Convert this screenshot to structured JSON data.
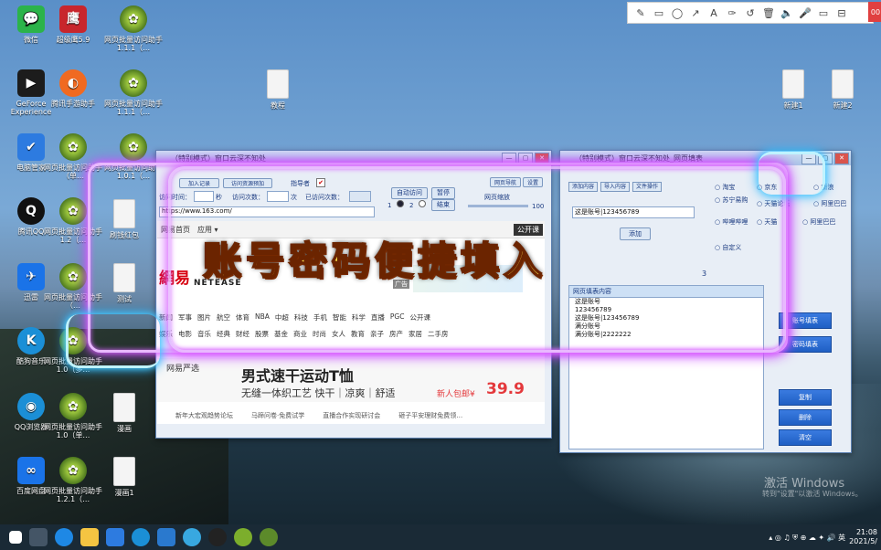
{
  "desktop_icons": [
    {
      "id": "wechat",
      "label": "微信",
      "style": "ic-green",
      "glyph": "💬"
    },
    {
      "id": "chaojiying",
      "label": "超级鹰5.9",
      "style": "ic-red",
      "glyph": "鹰"
    },
    {
      "id": "visit1",
      "label": "网页批量访问助手1.1.1（…",
      "style": "ic-tree",
      "glyph": "✿"
    },
    {
      "id": "geforce",
      "label": "GeForce Experience",
      "style": "ic-dark",
      "glyph": "▶"
    },
    {
      "id": "tencent-hand",
      "label": "腾讯手游助手",
      "style": "ic-orange",
      "glyph": "◐"
    },
    {
      "id": "visit2",
      "label": "网页批量访问助手1.1.1（…",
      "style": "ic-tree",
      "glyph": "✿"
    },
    {
      "id": "dianjiao",
      "label": "电脑管家",
      "style": "ic-shield",
      "glyph": "✔"
    },
    {
      "id": "visit3",
      "label": "网页批量访问助手（单…",
      "style": "ic-tree",
      "glyph": "✿"
    },
    {
      "id": "visit4",
      "label": "网页批量访问助手1.0.1（…",
      "style": "ic-tree",
      "glyph": "✿"
    },
    {
      "id": "qq",
      "label": "腾讯QQ",
      "style": "ic-qq",
      "glyph": "Q"
    },
    {
      "id": "visit5",
      "label": "网页批量访问助手1.2（…",
      "style": "ic-tree",
      "glyph": "✿"
    },
    {
      "id": "xunlei",
      "label": "迅雷",
      "style": "ic-blue",
      "glyph": "✈"
    },
    {
      "id": "visit6",
      "label": "网页批量访问助手（…",
      "style": "ic-tree",
      "glyph": "✿"
    },
    {
      "id": "kugou",
      "label": "酷狗音乐",
      "style": "ic-teal",
      "glyph": "K"
    },
    {
      "id": "visit7",
      "label": "网页批量访问助手1.0（多…",
      "style": "ic-tree",
      "glyph": "✿"
    },
    {
      "id": "qqbrowser",
      "label": "QQ浏览器",
      "style": "ic-teal",
      "glyph": "◉"
    },
    {
      "id": "visit8",
      "label": "网页批量访问助手1.0（单…",
      "style": "ic-tree",
      "glyph": "✿"
    },
    {
      "id": "baidunetdisk",
      "label": "百度网盘",
      "style": "ic-blue",
      "glyph": "∞"
    },
    {
      "id": "visit9",
      "label": "网页批量访问助手1.2.1（…",
      "style": "ic-tree",
      "glyph": "✿"
    },
    {
      "id": "file-manhua",
      "label": "漫画",
      "style": "ic-file",
      "glyph": ""
    },
    {
      "id": "file-manhua1",
      "label": "漫画1",
      "style": "ic-file",
      "glyph": ""
    },
    {
      "id": "file-shuayu",
      "label": "刷钱红包",
      "style": "ic-file",
      "glyph": ""
    },
    {
      "id": "file-ceshi",
      "label": "测试",
      "style": "ic-file",
      "glyph": ""
    },
    {
      "id": "file-guanggao",
      "label": "教程",
      "style": "ic-file",
      "glyph": ""
    },
    {
      "id": "file-right1",
      "label": "新建1",
      "style": "ic-file",
      "glyph": ""
    },
    {
      "id": "file-right2",
      "label": "新建2",
      "style": "ic-file",
      "glyph": ""
    }
  ],
  "annotation_toolbar": {
    "tools": [
      "✎",
      "▭",
      "◯",
      "↗",
      "A",
      "✑",
      "↺",
      "🗑",
      "🔈",
      "🎤",
      "▭",
      "⊟"
    ],
    "record": "00"
  },
  "left_window": {
    "title": "（特别模式）窗口云深不知处",
    "buttons": [
      "加入记录",
      "访问资源预加",
      "指导者"
    ],
    "visit_time_label": "访问时间：",
    "sec": "秒",
    "visit_count_label": "访问次数：",
    "times": "次",
    "visited_label": "已访问次数：",
    "auto_visit": "自动访问",
    "pause": "暂停",
    "end": "结束",
    "url": "https://www.163.com/",
    "speed_label": "网页缩放",
    "speed_val": "100",
    "radio_1": "1",
    "radio_2": "2",
    "right_top_btns": [
      "网页导航",
      "设置"
    ]
  },
  "browser": {
    "nav": [
      "网易首页",
      "应用 ▾"
    ],
    "open_class": "公开课",
    "logo_cn": "網易",
    "logo_en": "NETEASE",
    "ad_label": "广告",
    "rows": [
      [
        "新闻",
        "军事",
        "图片",
        "航空",
        "体育",
        "NBA",
        "中超",
        "科技",
        "手机",
        "智能",
        "科学",
        "直播",
        "PGC",
        "公开课"
      ],
      [
        "娱乐",
        "电影",
        "音乐",
        "经典",
        "财经",
        "股票",
        "基金",
        "商业",
        "时尚",
        "女人",
        "教育",
        "亲子",
        "房产",
        "家居",
        "二手房"
      ]
    ],
    "yanxuan": "网易严选",
    "promo_title": "男式速干运动T恤",
    "promo_sub": "无缝一体织工艺  快干｜凉爽｜舒适",
    "promo_price_label": "新人包邮¥",
    "promo_price": "39.9",
    "foot": [
      "新年大宏观趋势论坛",
      "马蹄问卷·免费试学",
      "直播合作实现研讨会",
      "砸子平安理财免费领…"
    ]
  },
  "right_window": {
    "title": "（特别模式）窗口云深不知处_网页填表",
    "tabs": [
      "添加内容",
      "导入内容",
      "文件操作"
    ],
    "select": "这是账号|123456789",
    "add_btn": "添加",
    "section_num": "3",
    "list_header": "网页填表内容",
    "list_rows": [
      "这是账号",
      "123456789",
      "这是账号|123456789",
      "满分账号",
      "满分账号|2222222"
    ],
    "sites": [
      "淘宝",
      "京东",
      "新浪",
      "苏宁易购",
      "天猫论坛",
      "阿里巴巴",
      "哔哩哔哩",
      "天猫",
      "阿里巴巴",
      "自定义"
    ],
    "right_btns": [
      "账号填表",
      "密码填表",
      "复制",
      "删除",
      "清空"
    ]
  },
  "overlay_text": "账号密码便捷填入",
  "watermark": {
    "line1": "激活 Windows",
    "line2": "转到\"设置\"以激活 Windows。"
  },
  "taskbar": {
    "time": "21:08",
    "date": "2021/5/"
  }
}
